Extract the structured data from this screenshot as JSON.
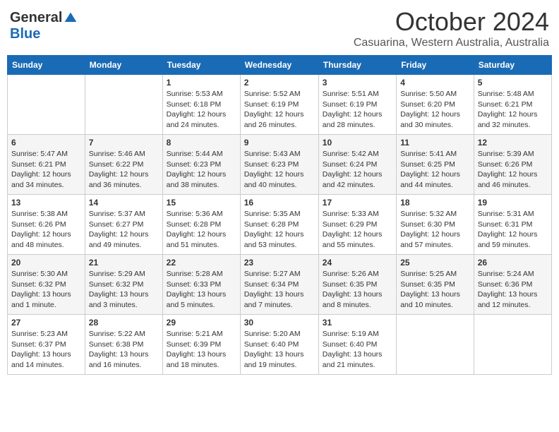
{
  "logo": {
    "general": "General",
    "blue": "Blue"
  },
  "header": {
    "title": "October 2024",
    "subtitle": "Casuarina, Western Australia, Australia"
  },
  "days_of_week": [
    "Sunday",
    "Monday",
    "Tuesday",
    "Wednesday",
    "Thursday",
    "Friday",
    "Saturday"
  ],
  "weeks": [
    [
      {
        "day": "",
        "sunrise": "",
        "sunset": "",
        "daylight": ""
      },
      {
        "day": "",
        "sunrise": "",
        "sunset": "",
        "daylight": ""
      },
      {
        "day": "1",
        "sunrise": "Sunrise: 5:53 AM",
        "sunset": "Sunset: 6:18 PM",
        "daylight": "Daylight: 12 hours and 24 minutes."
      },
      {
        "day": "2",
        "sunrise": "Sunrise: 5:52 AM",
        "sunset": "Sunset: 6:19 PM",
        "daylight": "Daylight: 12 hours and 26 minutes."
      },
      {
        "day": "3",
        "sunrise": "Sunrise: 5:51 AM",
        "sunset": "Sunset: 6:19 PM",
        "daylight": "Daylight: 12 hours and 28 minutes."
      },
      {
        "day": "4",
        "sunrise": "Sunrise: 5:50 AM",
        "sunset": "Sunset: 6:20 PM",
        "daylight": "Daylight: 12 hours and 30 minutes."
      },
      {
        "day": "5",
        "sunrise": "Sunrise: 5:48 AM",
        "sunset": "Sunset: 6:21 PM",
        "daylight": "Daylight: 12 hours and 32 minutes."
      }
    ],
    [
      {
        "day": "6",
        "sunrise": "Sunrise: 5:47 AM",
        "sunset": "Sunset: 6:21 PM",
        "daylight": "Daylight: 12 hours and 34 minutes."
      },
      {
        "day": "7",
        "sunrise": "Sunrise: 5:46 AM",
        "sunset": "Sunset: 6:22 PM",
        "daylight": "Daylight: 12 hours and 36 minutes."
      },
      {
        "day": "8",
        "sunrise": "Sunrise: 5:44 AM",
        "sunset": "Sunset: 6:23 PM",
        "daylight": "Daylight: 12 hours and 38 minutes."
      },
      {
        "day": "9",
        "sunrise": "Sunrise: 5:43 AM",
        "sunset": "Sunset: 6:23 PM",
        "daylight": "Daylight: 12 hours and 40 minutes."
      },
      {
        "day": "10",
        "sunrise": "Sunrise: 5:42 AM",
        "sunset": "Sunset: 6:24 PM",
        "daylight": "Daylight: 12 hours and 42 minutes."
      },
      {
        "day": "11",
        "sunrise": "Sunrise: 5:41 AM",
        "sunset": "Sunset: 6:25 PM",
        "daylight": "Daylight: 12 hours and 44 minutes."
      },
      {
        "day": "12",
        "sunrise": "Sunrise: 5:39 AM",
        "sunset": "Sunset: 6:26 PM",
        "daylight": "Daylight: 12 hours and 46 minutes."
      }
    ],
    [
      {
        "day": "13",
        "sunrise": "Sunrise: 5:38 AM",
        "sunset": "Sunset: 6:26 PM",
        "daylight": "Daylight: 12 hours and 48 minutes."
      },
      {
        "day": "14",
        "sunrise": "Sunrise: 5:37 AM",
        "sunset": "Sunset: 6:27 PM",
        "daylight": "Daylight: 12 hours and 49 minutes."
      },
      {
        "day": "15",
        "sunrise": "Sunrise: 5:36 AM",
        "sunset": "Sunset: 6:28 PM",
        "daylight": "Daylight: 12 hours and 51 minutes."
      },
      {
        "day": "16",
        "sunrise": "Sunrise: 5:35 AM",
        "sunset": "Sunset: 6:28 PM",
        "daylight": "Daylight: 12 hours and 53 minutes."
      },
      {
        "day": "17",
        "sunrise": "Sunrise: 5:33 AM",
        "sunset": "Sunset: 6:29 PM",
        "daylight": "Daylight: 12 hours and 55 minutes."
      },
      {
        "day": "18",
        "sunrise": "Sunrise: 5:32 AM",
        "sunset": "Sunset: 6:30 PM",
        "daylight": "Daylight: 12 hours and 57 minutes."
      },
      {
        "day": "19",
        "sunrise": "Sunrise: 5:31 AM",
        "sunset": "Sunset: 6:31 PM",
        "daylight": "Daylight: 12 hours and 59 minutes."
      }
    ],
    [
      {
        "day": "20",
        "sunrise": "Sunrise: 5:30 AM",
        "sunset": "Sunset: 6:32 PM",
        "daylight": "Daylight: 13 hours and 1 minute."
      },
      {
        "day": "21",
        "sunrise": "Sunrise: 5:29 AM",
        "sunset": "Sunset: 6:32 PM",
        "daylight": "Daylight: 13 hours and 3 minutes."
      },
      {
        "day": "22",
        "sunrise": "Sunrise: 5:28 AM",
        "sunset": "Sunset: 6:33 PM",
        "daylight": "Daylight: 13 hours and 5 minutes."
      },
      {
        "day": "23",
        "sunrise": "Sunrise: 5:27 AM",
        "sunset": "Sunset: 6:34 PM",
        "daylight": "Daylight: 13 hours and 7 minutes."
      },
      {
        "day": "24",
        "sunrise": "Sunrise: 5:26 AM",
        "sunset": "Sunset: 6:35 PM",
        "daylight": "Daylight: 13 hours and 8 minutes."
      },
      {
        "day": "25",
        "sunrise": "Sunrise: 5:25 AM",
        "sunset": "Sunset: 6:35 PM",
        "daylight": "Daylight: 13 hours and 10 minutes."
      },
      {
        "day": "26",
        "sunrise": "Sunrise: 5:24 AM",
        "sunset": "Sunset: 6:36 PM",
        "daylight": "Daylight: 13 hours and 12 minutes."
      }
    ],
    [
      {
        "day": "27",
        "sunrise": "Sunrise: 5:23 AM",
        "sunset": "Sunset: 6:37 PM",
        "daylight": "Daylight: 13 hours and 14 minutes."
      },
      {
        "day": "28",
        "sunrise": "Sunrise: 5:22 AM",
        "sunset": "Sunset: 6:38 PM",
        "daylight": "Daylight: 13 hours and 16 minutes."
      },
      {
        "day": "29",
        "sunrise": "Sunrise: 5:21 AM",
        "sunset": "Sunset: 6:39 PM",
        "daylight": "Daylight: 13 hours and 18 minutes."
      },
      {
        "day": "30",
        "sunrise": "Sunrise: 5:20 AM",
        "sunset": "Sunset: 6:40 PM",
        "daylight": "Daylight: 13 hours and 19 minutes."
      },
      {
        "day": "31",
        "sunrise": "Sunrise: 5:19 AM",
        "sunset": "Sunset: 6:40 PM",
        "daylight": "Daylight: 13 hours and 21 minutes."
      },
      {
        "day": "",
        "sunrise": "",
        "sunset": "",
        "daylight": ""
      },
      {
        "day": "",
        "sunrise": "",
        "sunset": "",
        "daylight": ""
      }
    ]
  ]
}
